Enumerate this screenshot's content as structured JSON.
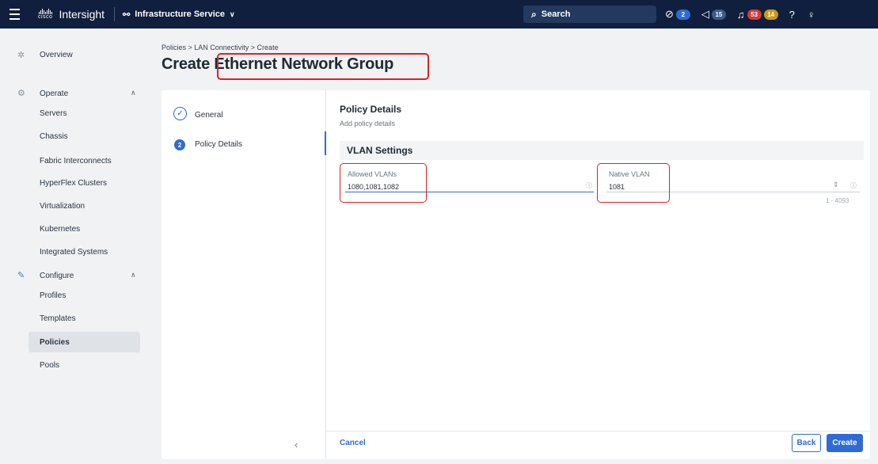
{
  "topbar": {
    "logo_text": "cisco",
    "app_name": "Intersight",
    "service": "Infrastructure Service",
    "search_label": "Search",
    "status_badge": "2",
    "announcements_count": "15",
    "alarm_critical": "53",
    "alarm_warning": "14"
  },
  "sidebar": {
    "overview": "Overview",
    "operate": "Operate",
    "operate_items": [
      "Servers",
      "Chassis",
      "Fabric Interconnects",
      "HyperFlex Clusters",
      "Virtualization",
      "Kubernetes",
      "Integrated Systems"
    ],
    "configure": "Configure",
    "configure_items": [
      "Profiles",
      "Templates",
      "Policies",
      "Pools"
    ]
  },
  "header": {
    "breadcrumb": "Policies  >  LAN Connectivity  >  Create",
    "title": "Create Ethernet Network Group"
  },
  "wizard": {
    "step1_label": "General",
    "step2_number": "2",
    "step2_label": "Policy Details"
  },
  "form": {
    "title": "Policy Details",
    "subtitle": "Add policy details",
    "section": "VLAN Settings",
    "allowed_vlans_label": "Allowed VLANs",
    "allowed_vlans_value": "1080,1081,1082",
    "native_vlan_label": "Native VLAN",
    "native_vlan_value": "1081",
    "native_vlan_range": "1 - 4093"
  },
  "footer": {
    "cancel": "Cancel",
    "back": "Back",
    "create": "Create"
  },
  "colors": {
    "topbar": "#0f1f3d",
    "accent": "#2f6bd6",
    "annotation": "#e02020"
  }
}
